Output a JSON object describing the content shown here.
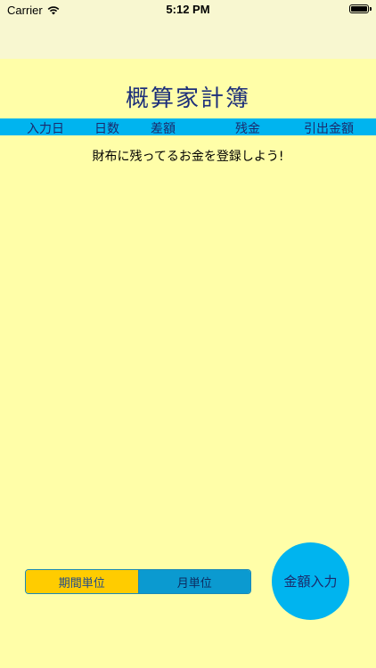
{
  "status_bar": {
    "carrier": "Carrier",
    "time": "5:12 PM",
    "icons": [
      "wifi-icon",
      "battery-icon"
    ]
  },
  "app": {
    "title": "概算家計簿",
    "prompt": "財布に残ってるお金を登録しよう!"
  },
  "table_header": {
    "date": "入力日",
    "days": "日数",
    "diff": "差額",
    "balance": "残金",
    "withdraw": "引出金額"
  },
  "segment": {
    "period_label": "期間単位",
    "month_label": "月単位",
    "selected": "期間単位"
  },
  "amount_button": {
    "label": "金額入力"
  },
  "colors": {
    "background": "#fffea8",
    "accent": "#00b4ef",
    "title": "#1d2f7a",
    "segment_selected": "#ffcc00"
  }
}
